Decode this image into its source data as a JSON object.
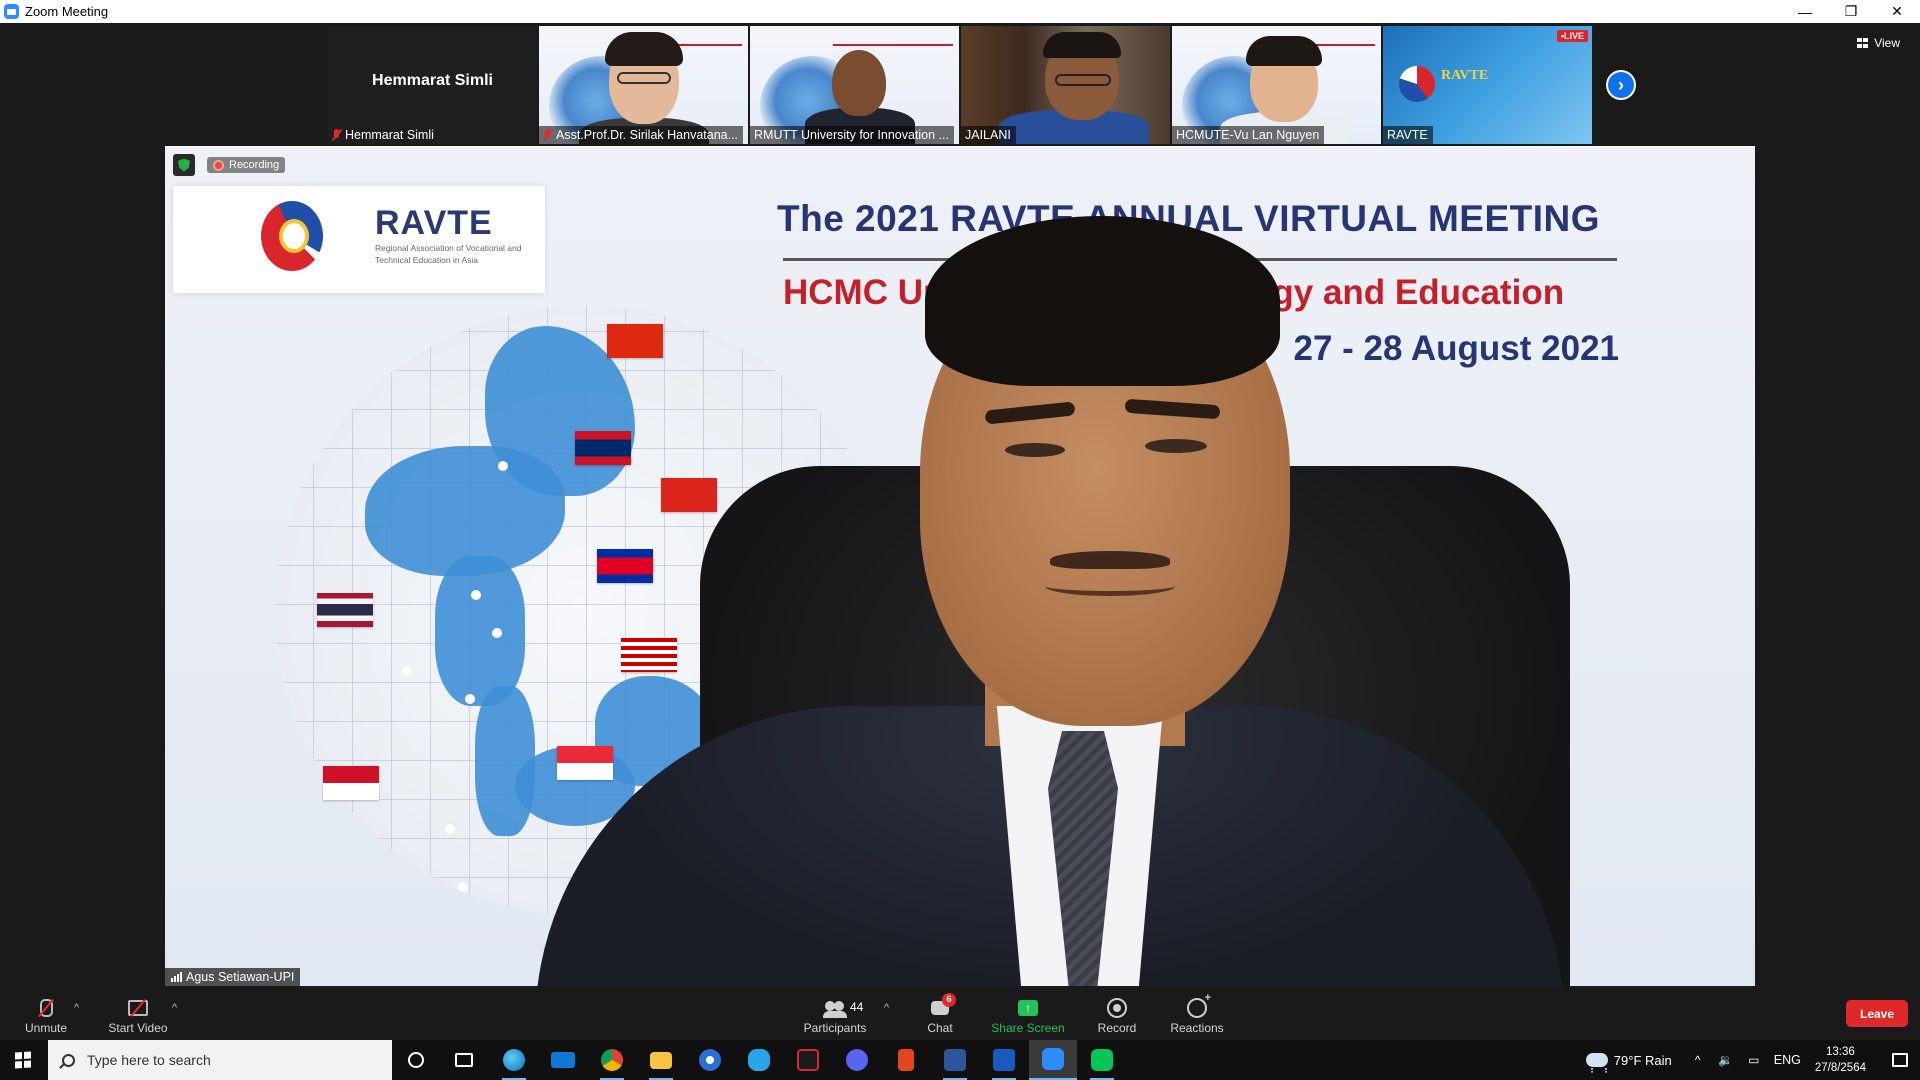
{
  "window": {
    "title": "Zoom Meeting",
    "minimize": "—",
    "restore": "❐",
    "close": "✕"
  },
  "strip": {
    "tiles": [
      {
        "name": "Hemmarat Simli",
        "center_name": "Hemmarat Simli",
        "muted": true
      },
      {
        "name": "Asst.Prof.Dr. Sirilak Hanvatana...",
        "muted": true
      },
      {
        "name": "RMUTT University for Innovation ...",
        "muted": false
      },
      {
        "name": "JAILANI",
        "muted": false
      },
      {
        "name": "HCMUTE-Vu Lan Nguyen",
        "muted": false
      },
      {
        "name": "RAVTE",
        "muted": false,
        "live_badge": "•LIVE",
        "logo_text": "RAVTE"
      }
    ],
    "next_arrow": "›"
  },
  "view": {
    "label": "View"
  },
  "main": {
    "recording_label": "Recording",
    "speaker_name": "Agus Setiawan-UPI",
    "slide": {
      "logo_title": "RAVTE",
      "logo_subtitle": "Regional Association of Vocational and Technical Education in Asia",
      "title": "The 2021 RAVTE ANNUAL VIRTUAL MEETING",
      "subtitle": "HCMC University of Technology and Education",
      "date": "27 - 28 August 2021"
    }
  },
  "controls": {
    "unmute": "Unmute",
    "start_video": "Start Video",
    "participants": "Participants",
    "participants_count": "44",
    "chat": "Chat",
    "chat_badge": "6",
    "share_screen": "Share Screen",
    "record": "Record",
    "reactions": "Reactions",
    "leave": "Leave",
    "caret": "^"
  },
  "taskbar": {
    "search_placeholder": "Type here to search",
    "weather": "79°F  Rain",
    "tray_up": "^",
    "volume": "🔉",
    "network": "▭",
    "language": "ENG",
    "time": "13:36",
    "date": "27/8/2564"
  },
  "colors": {
    "zoom_blue": "#0e72ed",
    "share_green": "#23c35a",
    "leave_red": "#e02828",
    "slide_navy": "#273574",
    "slide_red": "#c4202a"
  }
}
